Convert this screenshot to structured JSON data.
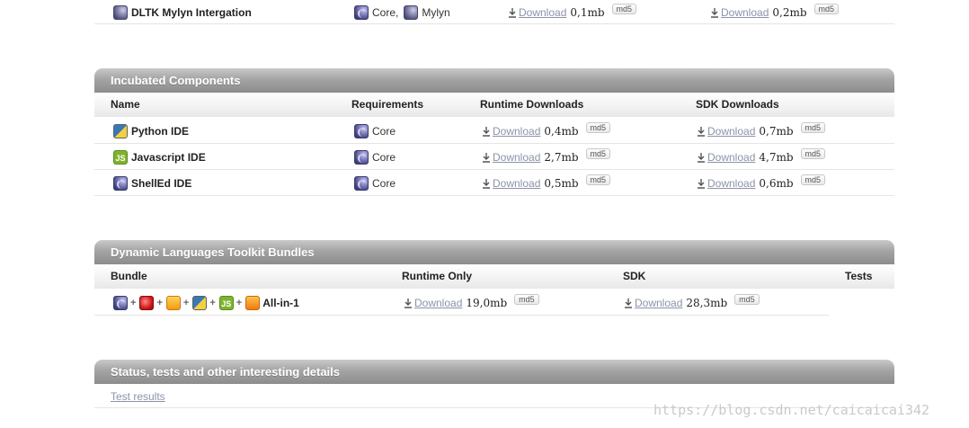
{
  "top_section": {
    "row": {
      "name": "DLTK Mylyn Intergation",
      "req_core": "Core,",
      "req_mylyn": "Mylyn",
      "runtime_link": "Download",
      "runtime_size": "0,1mb",
      "sdk_link": "Download",
      "sdk_size": "0,2mb",
      "md5": "md5"
    }
  },
  "incubated": {
    "title": "Incubated Components",
    "headers": {
      "name": "Name",
      "requirements": "Requirements",
      "runtime": "Runtime Downloads",
      "sdk": "SDK Downloads"
    },
    "rows": [
      {
        "name": "Python IDE",
        "icon": "python-icon",
        "req": "Core",
        "runtime_link": "Download",
        "runtime_size": "0,4mb",
        "sdk_link": "Download",
        "sdk_size": "0,7mb",
        "md5": "md5"
      },
      {
        "name": "Javascript IDE",
        "icon": "javascript-icon",
        "icon_text": "JS",
        "req": "Core",
        "runtime_link": "Download",
        "runtime_size": "2,7mb",
        "sdk_link": "Download",
        "sdk_size": "4,7mb",
        "md5": "md5"
      },
      {
        "name": "ShellEd IDE",
        "icon": "shelled-icon",
        "req": "Core",
        "runtime_link": "Download",
        "runtime_size": "0,5mb",
        "sdk_link": "Download",
        "sdk_size": "0,6mb",
        "md5": "md5"
      }
    ]
  },
  "bundles": {
    "title": "Dynamic Languages Toolkit Bundles",
    "headers": {
      "bundle": "Bundle",
      "runtime": "Runtime Only",
      "sdk": "SDK",
      "tests": "Tests"
    },
    "row": {
      "plus": "+",
      "js_text": "JS",
      "name": "All-in-1",
      "runtime_link": "Download",
      "runtime_size": "19,0mb",
      "sdk_link": "Download",
      "sdk_size": "28,3mb",
      "md5": "md5"
    }
  },
  "status": {
    "title": "Status, tests and other interesting details",
    "link": "Test results"
  },
  "watermark": "https://blog.csdn.net/caicaicai342",
  "colors": {
    "header_bar": "#a4a4a4",
    "link": "#8a93a8",
    "core_icon": "#5a5aa0"
  }
}
